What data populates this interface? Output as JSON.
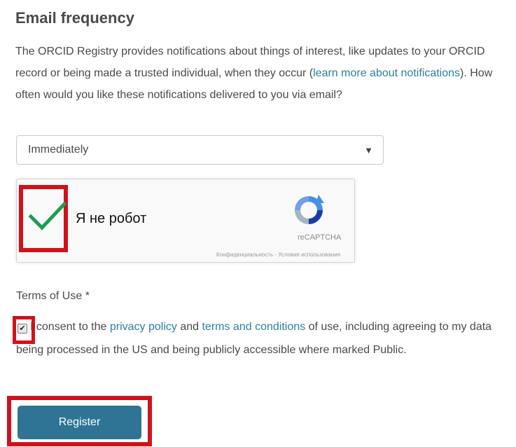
{
  "email_frequency": {
    "heading": "Email frequency",
    "description_before": "The ORCID Registry provides notifications about things of interest, like updates to your ORCID record or being made a trusted individual, when they occur (",
    "learn_more_link": "learn more about notifications",
    "description_after": "). How often would you like these notifications delivered to you via email?",
    "select_value": "Immediately"
  },
  "recaptcha": {
    "label": "Я не робот",
    "brand": "reCAPTCHA",
    "privacy_link": "Конфиденциальность",
    "separator": " - ",
    "terms_link": "Условия использования",
    "checked": true
  },
  "terms": {
    "label": "Terms of Use *",
    "consent_before": "I consent to the ",
    "privacy_link": "privacy policy",
    "and_text": " and ",
    "terms_link": "terms and conditions",
    "consent_after": " of use, including agreeing to my data being processed in the US and being publicly accessible where marked Public.",
    "checked": true
  },
  "register_button": "Register",
  "colors": {
    "link": "#2e7f9f",
    "button": "#2f7494",
    "highlight": "#d0121b",
    "check": "#1e9e53"
  },
  "icons": {
    "recaptcha_check": "check-icon",
    "recaptcha_logo": "recaptcha-logo-icon",
    "select_caret": "caret-down-icon"
  }
}
